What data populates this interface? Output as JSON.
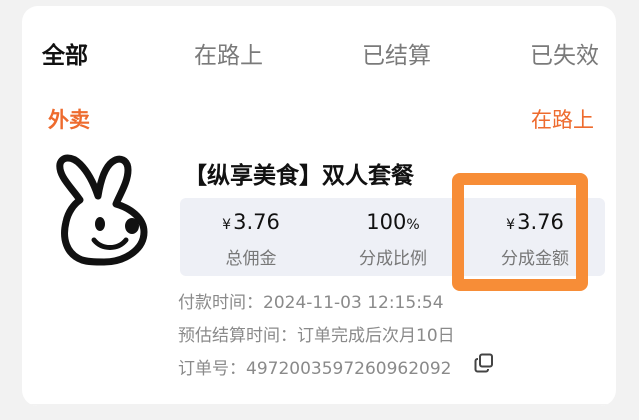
{
  "tabs": [
    {
      "label": "全部",
      "active": true
    },
    {
      "label": "在路上",
      "active": false
    },
    {
      "label": "已结算",
      "active": false
    },
    {
      "label": "已失效",
      "active": false
    }
  ],
  "order": {
    "category_tag": "外卖",
    "status": "在路上",
    "title": "【纵享美食】双人套餐",
    "stats": {
      "total_commission": {
        "currency": "¥",
        "value": "3.76",
        "label": "总佣金"
      },
      "share_ratio": {
        "value": "100",
        "unit": "%",
        "label": "分成比例"
      },
      "share_amount": {
        "currency": "¥",
        "value": "3.76",
        "label": "分成金额"
      }
    },
    "pay_time": {
      "label": "付款时间：",
      "value": "2024-11-03 12:15:54"
    },
    "settle_time": {
      "label": "预估结算时间：",
      "value": "订单完成后次月10日"
    },
    "order_no": {
      "label": "订单号：",
      "value": "4972003597260962092"
    }
  },
  "colors": {
    "accent": "#ee6b2e",
    "highlight": "#f78d37",
    "stats_bg": "#eef0f6"
  },
  "icons": {
    "logo": "rabbit-logo-icon",
    "copy": "copy-icon"
  }
}
